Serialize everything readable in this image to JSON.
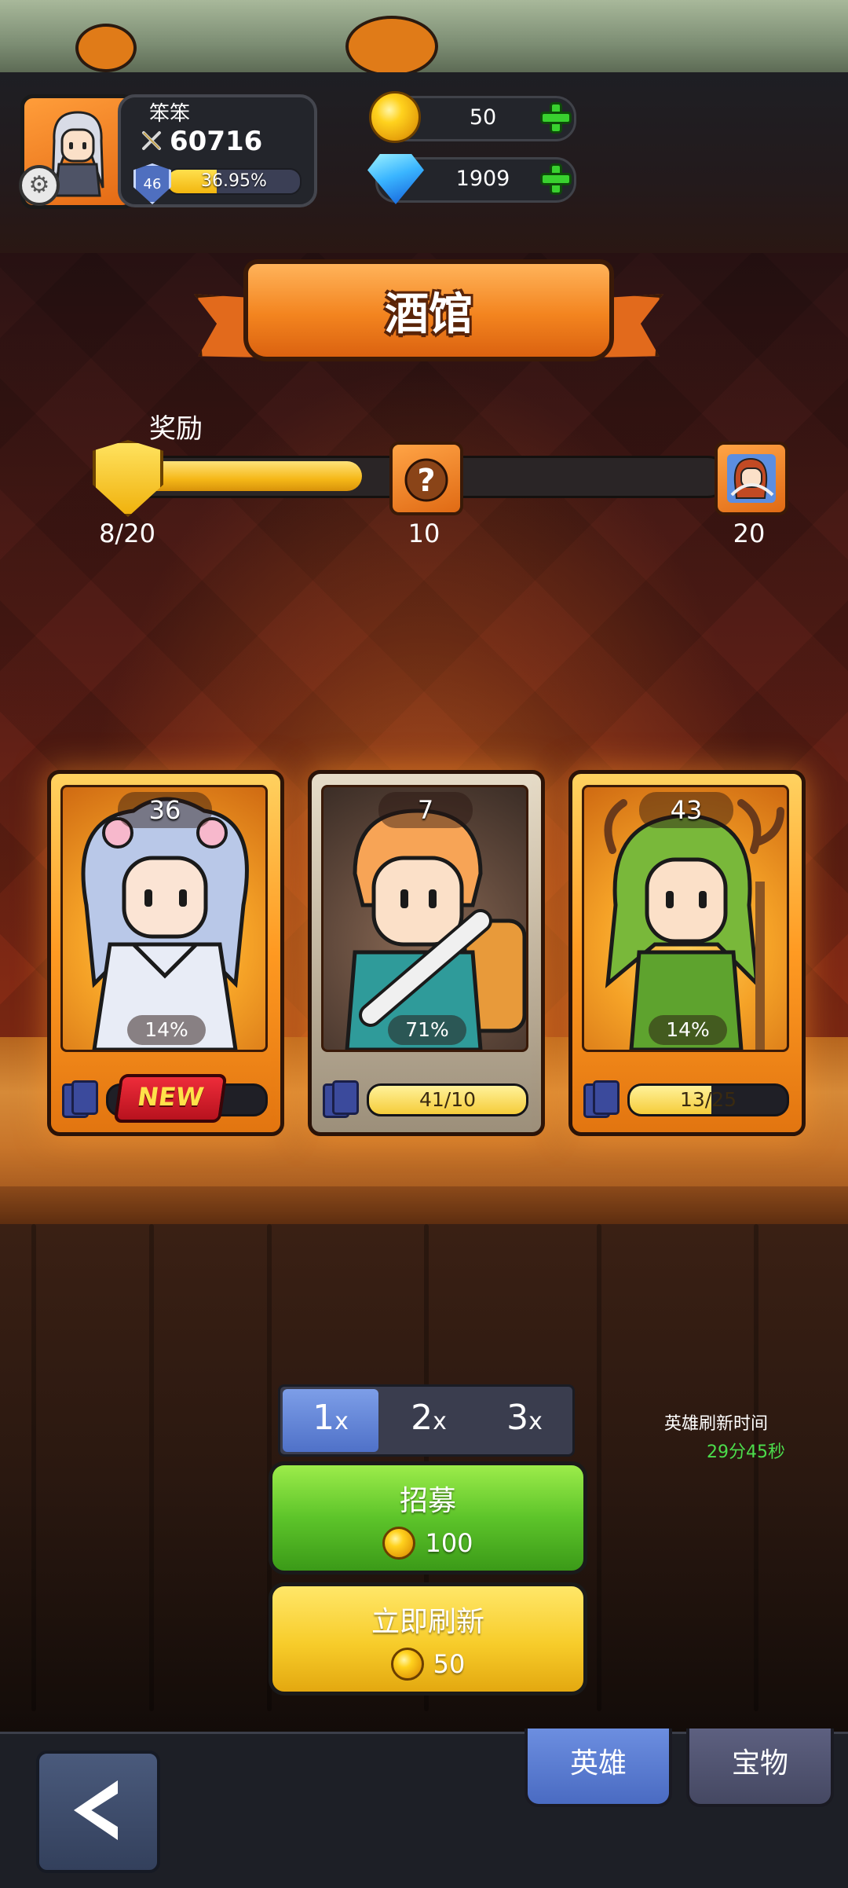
{
  "player": {
    "name": "笨笨",
    "power": "60716",
    "level": "46",
    "exp_percent_label": "36.95%",
    "exp_progress": 0.3695
  },
  "currency": {
    "gold": "50",
    "gems": "1909"
  },
  "banner": {
    "title": "酒馆"
  },
  "reward": {
    "label": "奖励",
    "progress_text": "8/20",
    "current": 8,
    "max": 20,
    "milestones": [
      "10",
      "20"
    ]
  },
  "heroes": [
    {
      "level": "36",
      "rate": "14%",
      "rarity": "gold",
      "badge": "NEW",
      "fragments": "",
      "fragment_progress": 0
    },
    {
      "level": "7",
      "rate": "71%",
      "rarity": "silver",
      "badge": "",
      "fragments": "41/10",
      "fragment_progress": 1.0
    },
    {
      "level": "43",
      "rate": "14%",
      "rarity": "gold",
      "badge": "",
      "fragments": "13/25",
      "fragment_progress": 0.52
    }
  ],
  "multiplier": {
    "options": [
      "1",
      "2",
      "3"
    ],
    "suffix": "x",
    "selected": "1"
  },
  "refresh_timer": {
    "label": "英雄刷新时间",
    "time": "29分45秒"
  },
  "recruit_button": {
    "label": "招募",
    "cost": "100"
  },
  "refresh_button": {
    "label": "立即刷新",
    "cost": "50"
  },
  "tabs": [
    {
      "label": "英雄",
      "active": true
    },
    {
      "label": "宝物",
      "active": false
    }
  ],
  "icons": {
    "back": "back-arrow-icon",
    "settings": "gear-icon",
    "gold": "gold-coin-icon",
    "gem": "diamond-icon",
    "add": "plus-icon"
  }
}
